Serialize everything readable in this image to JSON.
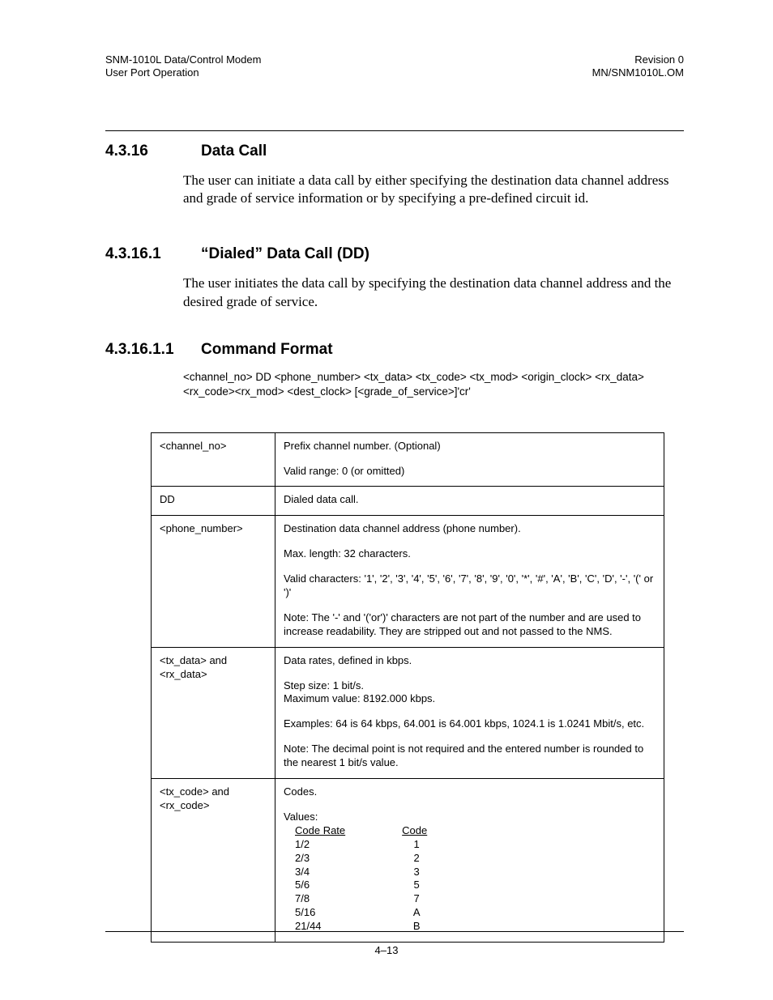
{
  "header": {
    "left1": "SNM-1010L Data/Control Modem",
    "left2": "User Port Operation",
    "right1": "Revision 0",
    "right2": "MN/SNM1010L.OM"
  },
  "sections": {
    "s1": {
      "num": "4.3.16",
      "title": "Data Call",
      "body": "The user can initiate a data call by either specifying the destination data channel address and grade of service information or by specifying a pre-defined circuit id."
    },
    "s2": {
      "num": "4.3.16.1",
      "title": "“Dialed” Data Call (DD)",
      "body": "The user initiates the data call by specifying the destination data channel address and the desired grade of service."
    },
    "s3": {
      "num": "4.3.16.1.1",
      "title": "Command Format",
      "cmd": " <channel_no> DD <phone_number> <tx_data> <tx_code> <tx_mod> <origin_clock> <rx_data> <rx_code><rx_mod> <dest_clock> [<grade_of_service>]'cr'"
    }
  },
  "table": {
    "r1": {
      "name": "<channel_no>",
      "l1": "Prefix channel number. (Optional)",
      "l2": "Valid range: 0 (or omitted)"
    },
    "r2": {
      "name": "DD",
      "l1": "Dialed data call."
    },
    "r3": {
      "name": "<phone_number>",
      "l1": "Destination data channel address (phone number).",
      "l2": "Max. length: 32 characters.",
      "l3": "Valid characters:  '1', '2', '3', '4', '5', '6', '7', '8', '9', '0', '*', '#', 'A', 'B', 'C', 'D', '-', '(' or ')'",
      "l4": "Note: The '-' and '('or')' characters are not part of the number and are used to increase readability. They are stripped out and not passed to the NMS."
    },
    "r4": {
      "name": "<tx_data> and <rx_data>",
      "l1": "Data rates, defined in kbps.",
      "l2a": "Step size: 1 bit/s.",
      "l2b": "Maximum value: 8192.000 kbps.",
      "l3": "Examples: 64 is 64 kbps, 64.001 is 64.001 kbps, 1024.1 is 1.0241 Mbit/s, etc.",
      "l4": "Note: The decimal point is not required and the entered number is rounded to the nearest 1 bit/s value."
    },
    "r5": {
      "name": "<tx_code> and <rx_code>",
      "l1": "Codes.",
      "l2": "Values:",
      "rateHdr": "Code Rate",
      "codeHdr": "Code",
      "rates": [
        "1/2",
        "2/3",
        "3/4",
        "5/6",
        "7/8",
        "5/16",
        "21/44"
      ],
      "codes": [
        "1",
        "2",
        "3",
        "5",
        "7",
        "A",
        "B"
      ]
    }
  },
  "footer": {
    "pagenum": "4–13"
  }
}
